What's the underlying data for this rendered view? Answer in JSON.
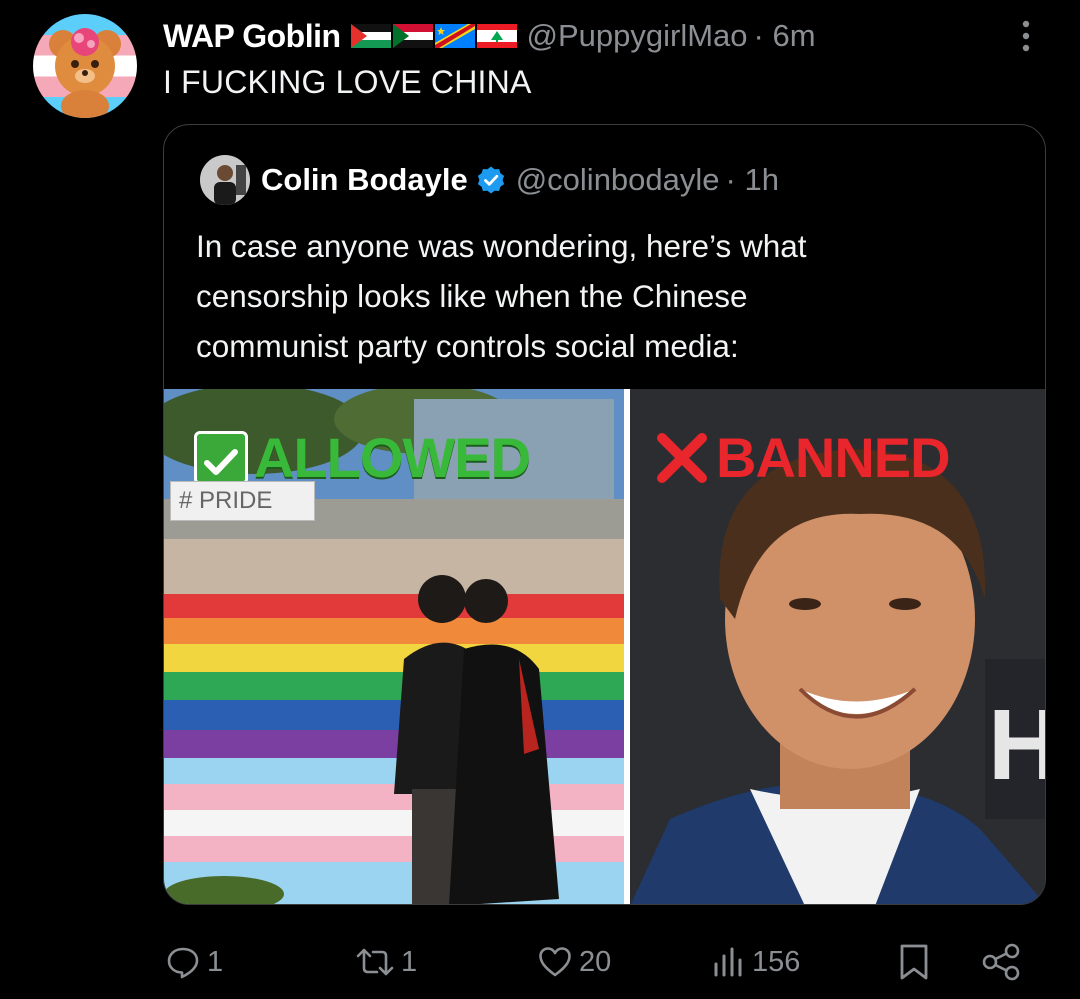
{
  "post": {
    "display_name": "WAP Goblin",
    "handle": "@PuppygirlMao",
    "time": "· 6m",
    "text": "I FUCKING LOVE CHINA",
    "flags": [
      "palestine-flag",
      "sudan-flag",
      "dr-congo-flag",
      "lebanon-flag"
    ]
  },
  "quote": {
    "display_name": "Colin Bodayle",
    "handle": "@colinbodayle",
    "time": "· 1h",
    "text_lines": [
      "In case anyone was wondering, here’s what",
      "censorship looks like when the Chinese",
      "communist party controls social media:"
    ],
    "media": {
      "left_label": "ALLOWED",
      "right_label": "BANNED",
      "sign_text": "#   PRIDE",
      "backdrop_text": "HI"
    }
  },
  "actions": {
    "replies": "1",
    "reposts": "1",
    "likes": "20",
    "views": "156"
  },
  "colors": {
    "background": "#000000",
    "secondary_text": "#8b8f93",
    "verified": "#1d9bf0",
    "allowed_green": "#39b93a",
    "banned_red": "#e8262c"
  }
}
